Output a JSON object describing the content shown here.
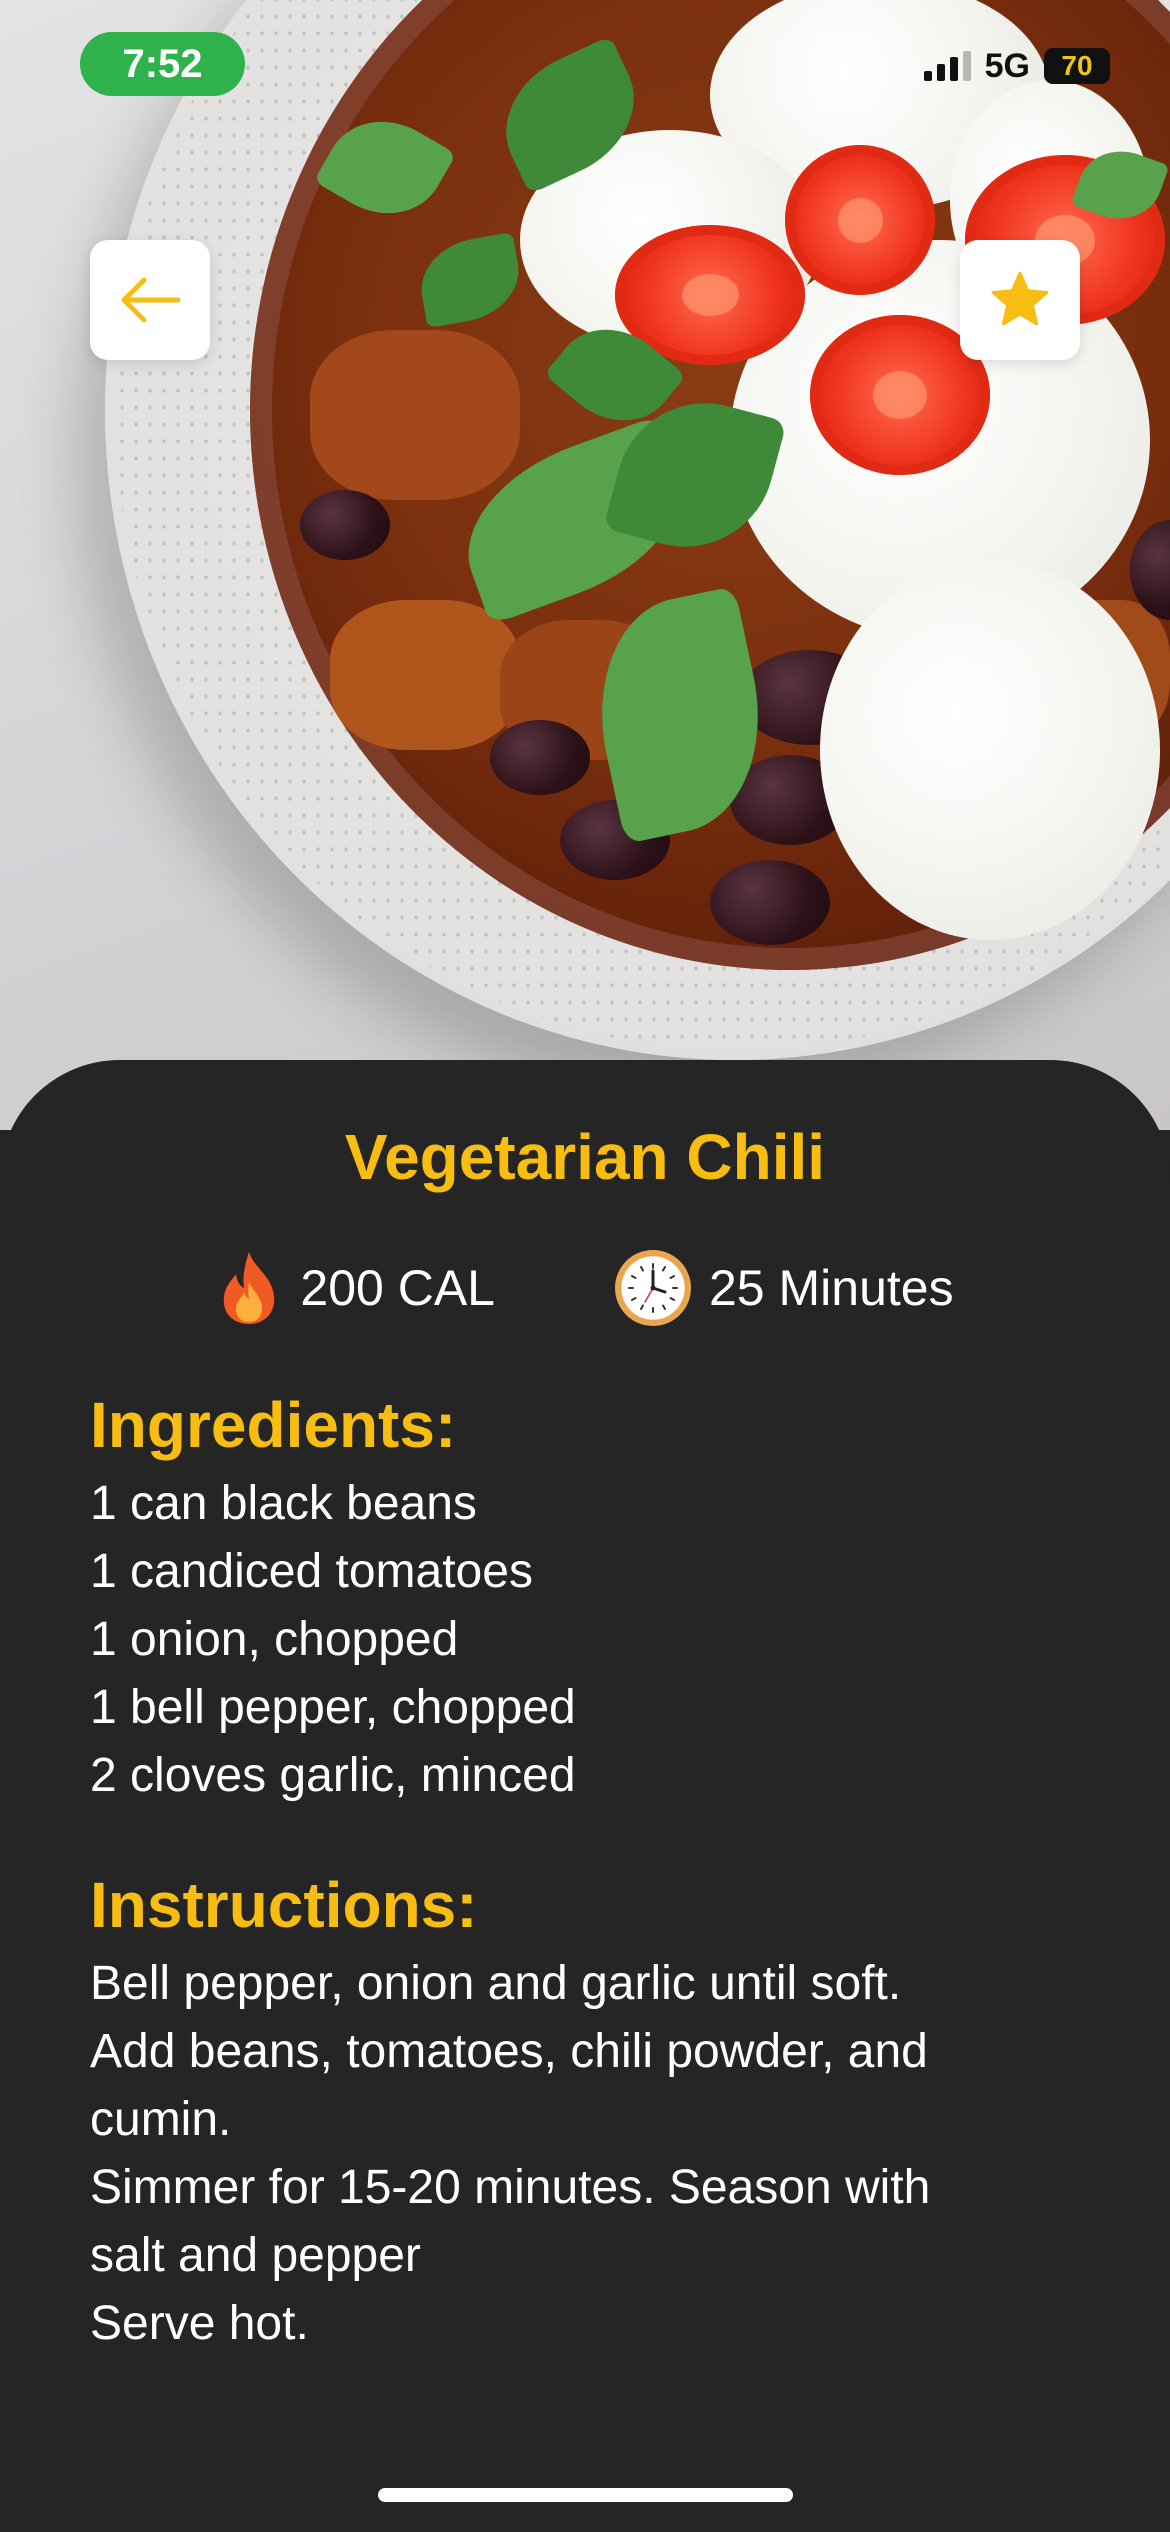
{
  "status_bar": {
    "time": "7:52",
    "network": "5G",
    "battery": "70"
  },
  "recipe": {
    "title": "Vegetarian Chili",
    "calories": "200 CAL",
    "time": "25 Minutes",
    "ingredients_heading": "Ingredients:",
    "ingredients": [
      "1 can black beans",
      "1 candiced tomatoes",
      "1 onion, chopped",
      "1 bell pepper, chopped",
      "2 cloves garlic, minced"
    ],
    "instructions_heading": "Instructions:",
    "instructions": [
      "Bell pepper, onion and garlic until soft.",
      "Add beans, tomatoes, chili powder, and",
      "cumin.",
      "Simmer for 15-20 minutes. Season with",
      "salt and pepper",
      "Serve hot."
    ]
  },
  "icons": {
    "back": "arrow-left-icon",
    "favorite": "star-icon",
    "calories": "fire-icon",
    "time": "clock-icon"
  },
  "colors": {
    "accent": "#f8bd13",
    "sheet_bg": "#252525",
    "time_pill": "#2fb24c"
  }
}
